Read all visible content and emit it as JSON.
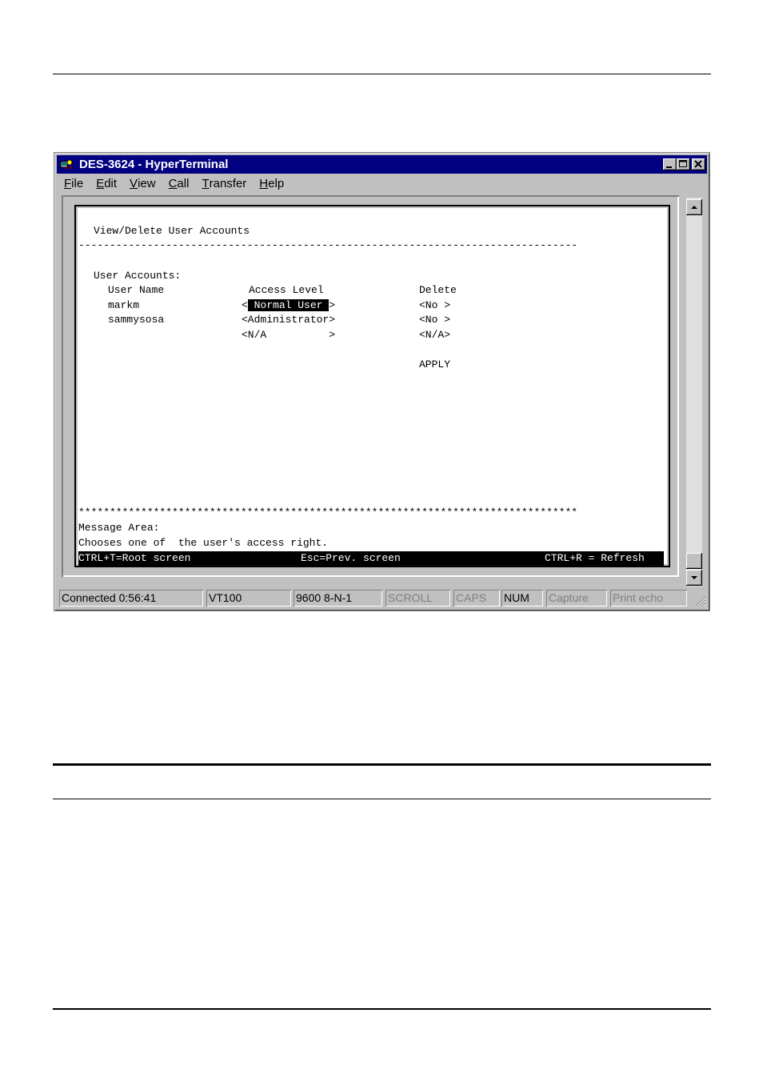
{
  "window": {
    "title": "DES-3624 - HyperTerminal",
    "menu": [
      {
        "mnemonic": "F",
        "rest": "ile"
      },
      {
        "mnemonic": "E",
        "rest": "dit"
      },
      {
        "mnemonic": "V",
        "rest": "iew"
      },
      {
        "mnemonic": "C",
        "rest": "all"
      },
      {
        "mnemonic": "T",
        "rest": "ransfer"
      },
      {
        "mnemonic": "H",
        "rest": "elp"
      }
    ]
  },
  "terminal": {
    "screen_title": "View/Delete User Accounts",
    "dash_line": "--------------------------------------------------------------------------------",
    "section_label": "User Accounts:",
    "col_user": "User Name",
    "col_access": "Access Level",
    "col_delete": "Delete",
    "rows": [
      {
        "user": "markm",
        "access_left": "<",
        "access": " Normal User ",
        "access_right": ">",
        "delete": "<No >"
      },
      {
        "user": "sammysosa",
        "access_full": "<Administrator>",
        "delete": "<No >"
      },
      {
        "user": "",
        "access_full": "<N/A          >",
        "delete": "<N/A>"
      }
    ],
    "apply": "APPLY",
    "star_line": "********************************************************************************",
    "message_label": "Message Area:",
    "message_text": "Chooses one of  the user's access right.",
    "footer_left": "CTRL+T=Root screen",
    "footer_mid": "Esc=Prev. screen",
    "footer_right": "CTRL+R = Refresh"
  },
  "statusbar": {
    "connected": "Connected 0:56:41",
    "emulation": "VT100",
    "port": "9600 8-N-1",
    "scroll": "SCROLL",
    "caps": "CAPS",
    "num": "NUM",
    "capture": "Capture",
    "print_echo": "Print echo"
  }
}
